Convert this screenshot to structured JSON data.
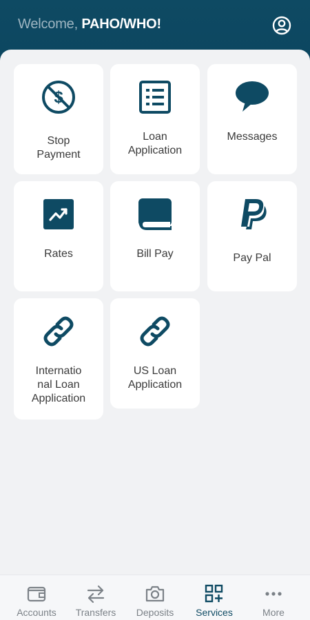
{
  "header": {
    "welcome_prefix": "Welcome, ",
    "org_name": "PAHO/WHO!",
    "profile_icon": "user-circle-icon"
  },
  "tiles": [
    {
      "label": "Stop\nPayment",
      "icon": "stop-payment-icon"
    },
    {
      "label": "Loan\nApplication",
      "icon": "list-document-icon"
    },
    {
      "label": "Messages",
      "icon": "chat-bubble-icon"
    },
    {
      "label": "Rates",
      "icon": "trend-chart-icon"
    },
    {
      "label": "Bill Pay",
      "icon": "book-icon"
    },
    {
      "label": "Pay Pal",
      "icon": "paypal-icon"
    },
    {
      "label": "Internatio\nnal Loan\nApplication",
      "icon": "link-icon"
    },
    {
      "label": "US Loan\nApplication",
      "icon": "link-icon"
    }
  ],
  "nav": {
    "items": [
      {
        "label": "Accounts",
        "icon": "wallet-icon"
      },
      {
        "label": "Transfers",
        "icon": "transfer-arrows-icon"
      },
      {
        "label": "Deposits",
        "icon": "camera-icon"
      },
      {
        "label": "Services",
        "icon": "services-grid-icon",
        "active": true
      },
      {
        "label": "More",
        "icon": "more-dots-icon"
      }
    ]
  },
  "colors": {
    "brand": "#0e4a63",
    "background": "#f1f2f4",
    "tile": "#ffffff",
    "nav_inactive": "#7b8187"
  }
}
